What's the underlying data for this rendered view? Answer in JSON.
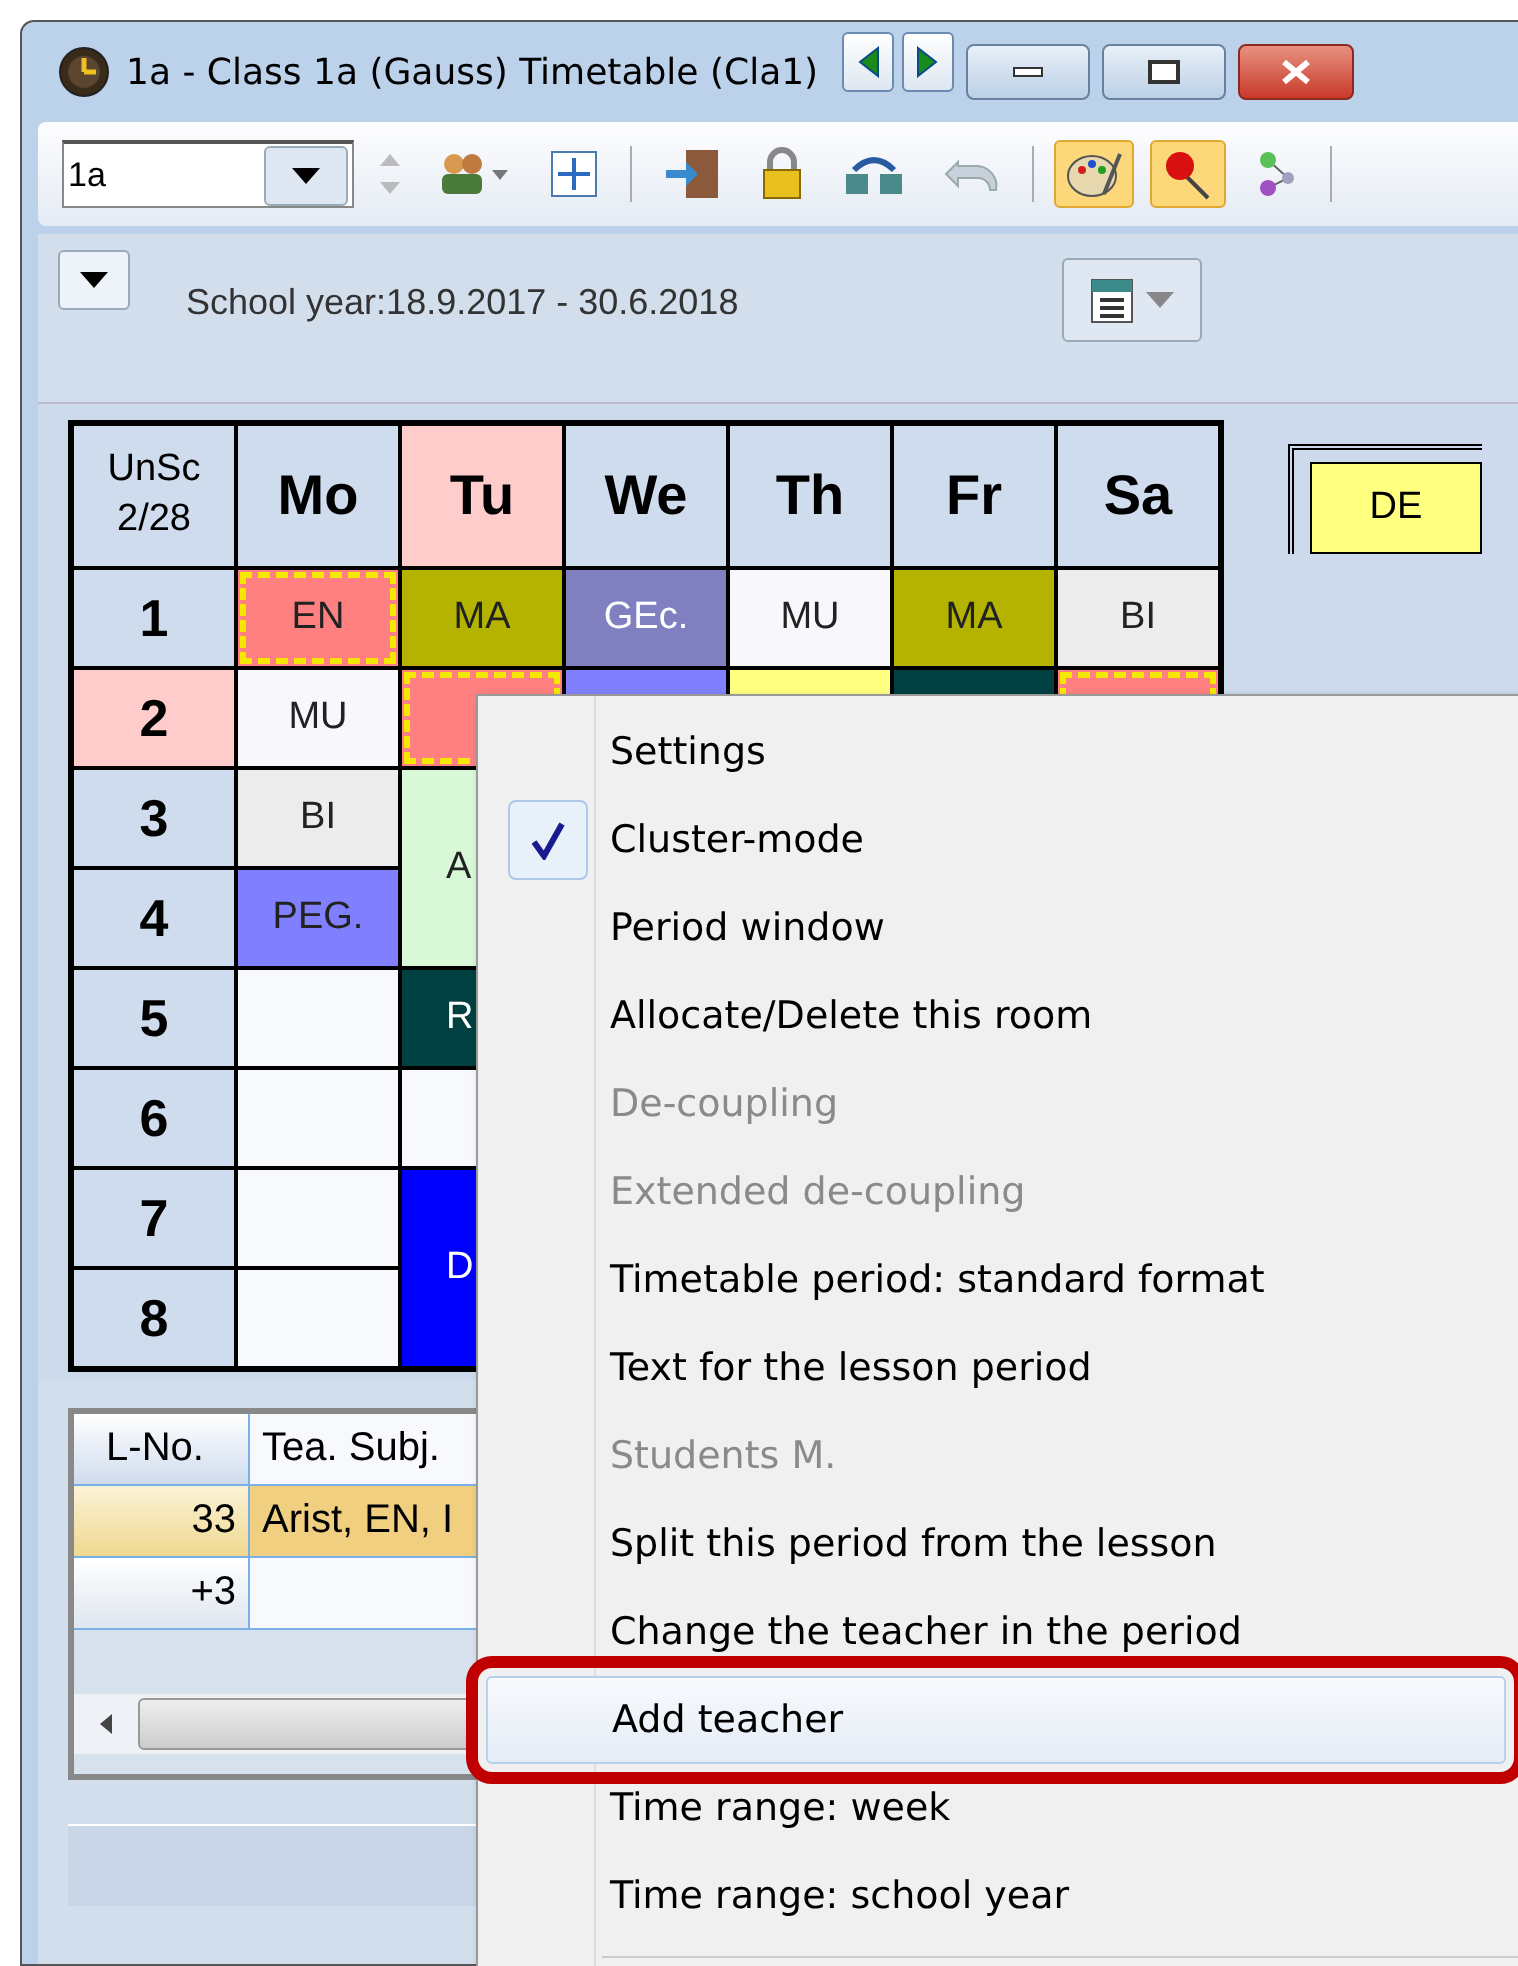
{
  "window": {
    "title": "1a - Class 1a (Gauss)  Timetable  (Cla1)"
  },
  "toolbar": {
    "class_field": {
      "value": "1a"
    },
    "tools": [
      {
        "kind": "people",
        "on": false
      },
      {
        "kind": "fit",
        "on": false
      },
      {
        "kind": "door",
        "on": false
      },
      {
        "kind": "lock",
        "on": false
      },
      {
        "kind": "swap",
        "on": false
      },
      {
        "kind": "undo",
        "on": false
      },
      {
        "kind": "palette",
        "on": true
      },
      {
        "kind": "pin",
        "on": true
      },
      {
        "kind": "nodes",
        "on": false
      }
    ]
  },
  "info_bar": {
    "text": "School year:18.9.2017 - 30.6.2018"
  },
  "timetable": {
    "corner": [
      "UnSc",
      "2/28"
    ],
    "periods": [
      {
        "label": "1",
        "selected": false
      },
      {
        "label": "2",
        "selected": true
      },
      {
        "label": "3",
        "selected": false
      },
      {
        "label": "4",
        "selected": false
      },
      {
        "label": "5",
        "selected": false
      },
      {
        "label": "6",
        "selected": false
      },
      {
        "label": "7",
        "selected": false
      },
      {
        "label": "8",
        "selected": false
      }
    ],
    "days": [
      {
        "label": "Mo",
        "selected": false,
        "cells": [
          {
            "kind": "single",
            "subject": "EN",
            "color": "#ff8080",
            "marked": true
          },
          {
            "kind": "single",
            "subject": "MU",
            "color": "#f8f8fc",
            "marked": false
          },
          {
            "kind": "single",
            "subject": "BI",
            "color": "#ececec",
            "marked": false
          },
          {
            "kind": "single",
            "subject": "PEG.",
            "color": "#8080ff",
            "marked": false
          },
          {
            "kind": "empty"
          },
          {
            "kind": "empty"
          },
          {
            "kind": "empty"
          },
          {
            "kind": "empty"
          }
        ]
      },
      {
        "label": "Tu",
        "selected": true,
        "cells": [
          {
            "kind": "single",
            "subject": "MA",
            "color": "#b4b400",
            "marked": false
          },
          {
            "kind": "single",
            "color": "#ff8080",
            "marked": true
          },
          {
            "kind": "double",
            "subject": "A",
            "cut": true,
            "color": "#d8f8d8",
            "marked": false
          },
          {
            "kind": "single",
            "subject": "R",
            "cut": true,
            "color": "#004040",
            "marked": false
          },
          {
            "kind": "empty"
          },
          {
            "kind": "double",
            "subject": "D",
            "cut": true,
            "color": "#0000ff",
            "marked": false
          }
        ]
      },
      {
        "label": "We",
        "selected": false,
        "cells": [
          {
            "kind": "single",
            "subject": "GEc.",
            "color": "#8080c0",
            "marked": false
          },
          {
            "kind": "single",
            "color": "#8080ff",
            "marked": false
          }
        ]
      },
      {
        "label": "Th",
        "selected": false,
        "cells": [
          {
            "kind": "single",
            "subject": "MU",
            "color": "#f8f8fc",
            "marked": false
          },
          {
            "kind": "single",
            "color": "#ffff80",
            "marked": false
          }
        ]
      },
      {
        "label": "Fr",
        "selected": false,
        "cells": [
          {
            "kind": "single",
            "subject": "MA",
            "color": "#b4b400",
            "marked": false
          },
          {
            "kind": "single",
            "color": "#004040",
            "marked": false
          }
        ]
      },
      {
        "label": "Sa",
        "selected": false,
        "cells": [
          {
            "kind": "single",
            "subject": "BI",
            "color": "#ececec",
            "marked": false
          },
          {
            "kind": "single",
            "color": "#ff8080",
            "marked": true
          }
        ]
      }
    ],
    "unscheduled": [
      {
        "subject": "DE",
        "color": "#ffff80"
      }
    ]
  },
  "lesson_table": {
    "columns": [
      "L-No.",
      "Tea. Subj."
    ],
    "rows": [
      {
        "l_no": "33",
        "tea_subj": "Arist, EN, I",
        "selected": true
      },
      {
        "l_no": "+3",
        "selected": false
      }
    ]
  },
  "context_menu": {
    "items": [
      {
        "label": "Settings",
        "checked": false,
        "disabled": false,
        "selected": false
      },
      {
        "label": "Cluster-mode",
        "checked": true,
        "disabled": false,
        "selected": false
      },
      {
        "label": "Period window",
        "checked": false,
        "disabled": false,
        "selected": false
      },
      {
        "label": "Allocate/Delete this room",
        "checked": false,
        "disabled": false,
        "selected": false
      },
      {
        "label": "De-coupling",
        "checked": false,
        "disabled": true,
        "selected": false
      },
      {
        "label": "Extended de-coupling",
        "checked": false,
        "disabled": true,
        "selected": false
      },
      {
        "label": "Timetable period: standard format",
        "checked": false,
        "disabled": false,
        "selected": false
      },
      {
        "label": "Text for the lesson period",
        "checked": false,
        "disabled": false,
        "selected": false
      },
      {
        "label": "Students M.",
        "checked": false,
        "disabled": true,
        "selected": false
      },
      {
        "label": "Split this period from the lesson",
        "checked": false,
        "disabled": false,
        "selected": false
      },
      {
        "label": "Change the teacher in the period",
        "checked": false,
        "disabled": false,
        "selected": false
      },
      {
        "label": "Add teacher",
        "checked": false,
        "disabled": false,
        "selected": true
      },
      {
        "label": "Time range: week",
        "checked": false,
        "disabled": false,
        "selected": false
      },
      {
        "label": "Time range: school year",
        "checked": false,
        "disabled": false,
        "selected": false
      }
    ]
  }
}
